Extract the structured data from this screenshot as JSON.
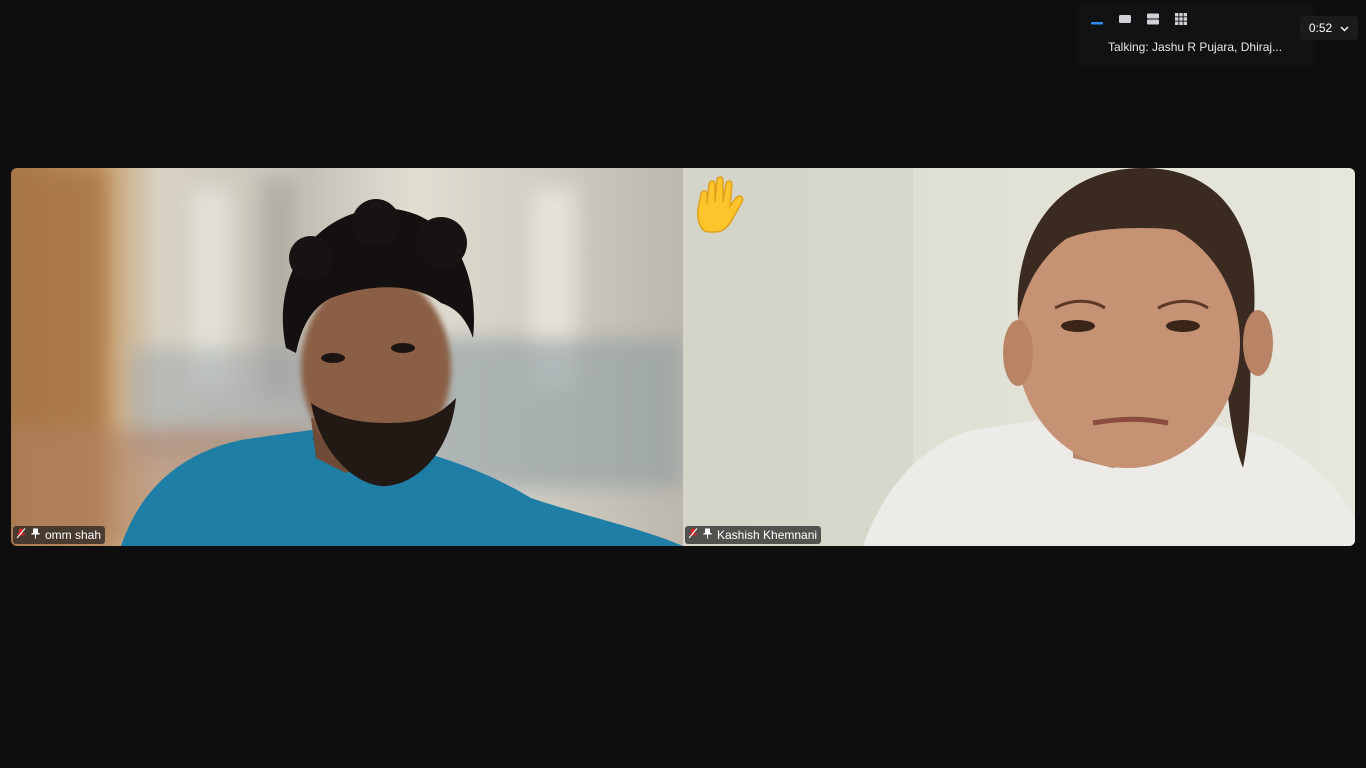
{
  "toolbar": {
    "view_icons": [
      "speaker-view-icon",
      "single-view-icon",
      "split-view-icon",
      "gallery-view-icon"
    ],
    "talking_text": "Talking: Jashu R Pujara, Dhiraj...",
    "timer": "0:52"
  },
  "participants": [
    {
      "name": "omm shah",
      "muted": true,
      "pinned": true,
      "hand_raised": false
    },
    {
      "name": "Kashish Khemnani",
      "muted": true,
      "pinned": true,
      "hand_raised": true
    }
  ],
  "colors": {
    "background": "#0e0e0f",
    "active_view": "#2d8cff",
    "muted_icon": "#e02828"
  }
}
